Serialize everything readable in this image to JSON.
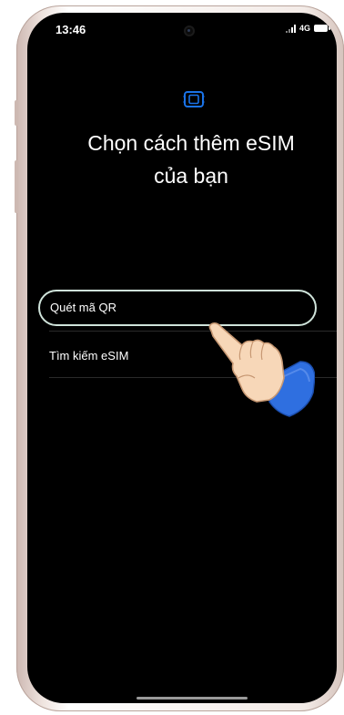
{
  "status_bar": {
    "time": "13:46",
    "network": "4G"
  },
  "screen": {
    "icon": "esim-icon",
    "title_line1": "Chọn cách thêm eSIM",
    "title_line2": "của bạn"
  },
  "options": [
    {
      "label": "Quét mã QR",
      "selected": true
    },
    {
      "label": "Tìm kiếm eSIM",
      "selected": false
    }
  ],
  "colors": {
    "screen_background": "#000000",
    "accent_blue": "#1a73e8",
    "selected_outline": "#cfe3da",
    "text": "#ffffff"
  },
  "overlay": {
    "icon": "pointing-hand-icon"
  }
}
